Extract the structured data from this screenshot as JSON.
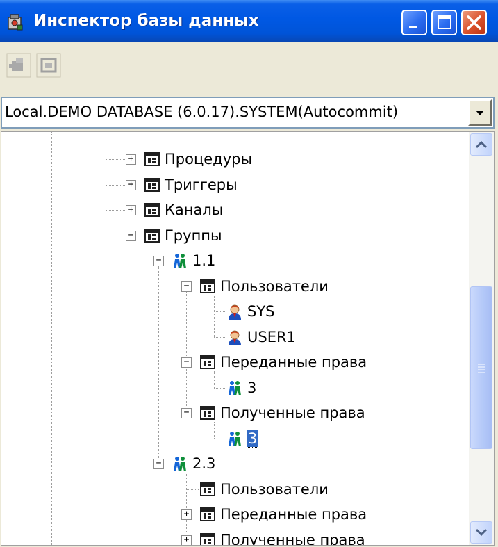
{
  "window": {
    "title": "Инспектор базы данных",
    "icon": "database-inspector-icon",
    "buttons": [
      "minimize",
      "maximize",
      "close"
    ]
  },
  "toolbar": {
    "buttons": [
      {
        "icon": "connect-icon",
        "enabled": false
      },
      {
        "icon": "disconnect-icon",
        "enabled": false
      }
    ]
  },
  "database_select": {
    "value": "Local.DEMO DATABASE (6.0.17).SYSTEM(Autocommit)"
  },
  "tree": {
    "nodes": [
      {
        "label": "Процедуры",
        "icon": "folder-table-icon",
        "state": "collapsed"
      },
      {
        "label": "Триггеры",
        "icon": "folder-table-icon",
        "state": "collapsed"
      },
      {
        "label": "Каналы",
        "icon": "folder-table-icon",
        "state": "collapsed"
      },
      {
        "label": "Группы",
        "icon": "folder-table-icon",
        "state": "expanded"
      },
      {
        "label": "1.1",
        "icon": "group-icon",
        "state": "expanded"
      },
      {
        "label": "Пользователи",
        "icon": "folder-table-icon",
        "state": "expanded"
      },
      {
        "label": "SYS",
        "icon": "user-icon",
        "state": "leaf"
      },
      {
        "label": "USER1",
        "icon": "user-icon",
        "state": "leaf"
      },
      {
        "label": "Переданные права",
        "icon": "folder-table-icon",
        "state": "expanded"
      },
      {
        "label": "3",
        "icon": "group-icon",
        "state": "leaf"
      },
      {
        "label": "Полученные права",
        "icon": "folder-table-icon",
        "state": "expanded"
      },
      {
        "label": "3",
        "icon": "group-icon",
        "state": "leaf",
        "selected": true
      },
      {
        "label": "2.3",
        "icon": "group-icon",
        "state": "expanded"
      },
      {
        "label": "Пользователи",
        "icon": "folder-table-icon",
        "state": "leaf"
      },
      {
        "label": "Переданные права",
        "icon": "folder-table-icon",
        "state": "collapsed"
      },
      {
        "label": "Полученные права",
        "icon": "folder-table-icon",
        "state": "collapsed"
      }
    ]
  },
  "colors": {
    "titlebar": "#0058e3",
    "selection": "#316ac5",
    "close_button": "#d9502b"
  }
}
